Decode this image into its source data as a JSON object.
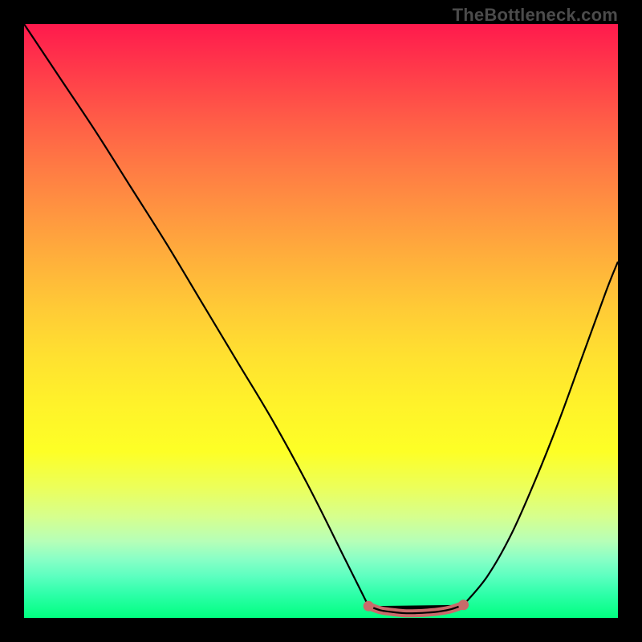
{
  "attribution": "TheBottleneck.com",
  "chart_data": {
    "type": "line",
    "title": "",
    "xlabel": "",
    "ylabel": "",
    "xlim": [
      0,
      100
    ],
    "ylim": [
      0,
      100
    ],
    "grid": false,
    "legend": false,
    "series": [
      {
        "name": "left-branch",
        "x": [
          0,
          6,
          12,
          18,
          24,
          30,
          36,
          42,
          48,
          54,
          58
        ],
        "y": [
          100,
          91,
          82,
          72.5,
          63,
          53,
          43,
          33,
          22,
          10,
          2
        ]
      },
      {
        "name": "flat-bottom",
        "x": [
          58,
          60,
          62,
          64,
          66,
          68,
          70,
          72,
          74
        ],
        "y": [
          2,
          1.3,
          1,
          0.8,
          0.8,
          0.9,
          1.1,
          1.5,
          2.2
        ]
      },
      {
        "name": "right-branch",
        "x": [
          74,
          78,
          82,
          86,
          90,
          94,
          98,
          100
        ],
        "y": [
          2.2,
          7,
          14,
          23,
          33,
          44,
          55,
          60
        ]
      }
    ],
    "annotations": [
      {
        "type": "highlight-segment",
        "series": "flat-bottom",
        "color": "#c96a6a"
      }
    ]
  }
}
